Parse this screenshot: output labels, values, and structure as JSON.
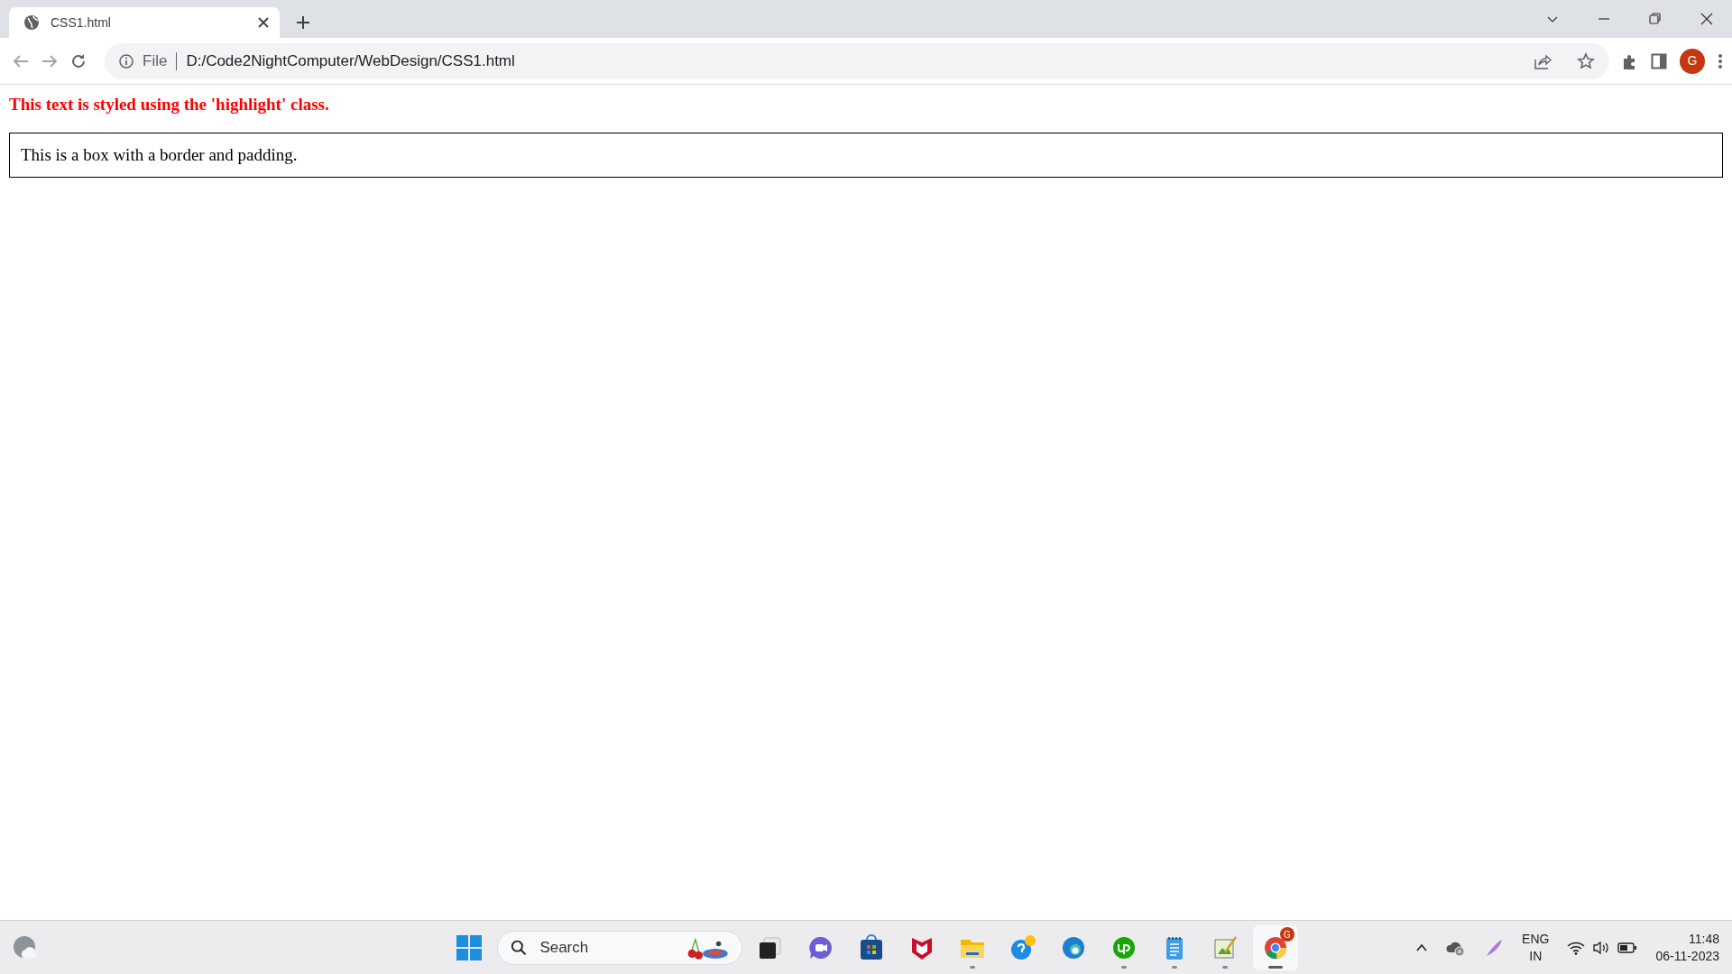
{
  "browser": {
    "tabs": [
      {
        "title": "CSS1.html",
        "selected": true
      }
    ],
    "address_bar": {
      "scheme": "File",
      "url": "D:/Code2NightComputer/WebDesign/CSS1.html"
    },
    "profile_initial": "G"
  },
  "page": {
    "highlight_text": "This text is styled using the 'highlight' class.",
    "box_text": "This is a box with a border and padding."
  },
  "taskbar": {
    "search_placeholder": "Search",
    "apps": [
      {
        "kind": "task-view",
        "running": false,
        "active": false
      },
      {
        "kind": "chat",
        "running": false,
        "active": false
      },
      {
        "kind": "store",
        "running": false,
        "active": false
      },
      {
        "kind": "shield",
        "running": false,
        "active": false
      },
      {
        "kind": "folder",
        "running": true,
        "active": false
      },
      {
        "kind": "help",
        "running": false,
        "active": false
      },
      {
        "kind": "edge",
        "running": false,
        "active": false
      },
      {
        "kind": "upwork",
        "running": true,
        "active": false
      },
      {
        "kind": "notepad",
        "running": true,
        "active": false
      },
      {
        "kind": "paint",
        "running": true,
        "active": false
      },
      {
        "kind": "chrome",
        "running": true,
        "active": true,
        "badge": "G"
      }
    ],
    "tray": {
      "language": "ENG",
      "region": "IN",
      "time": "11:48",
      "date": "06-11-2023"
    }
  }
}
